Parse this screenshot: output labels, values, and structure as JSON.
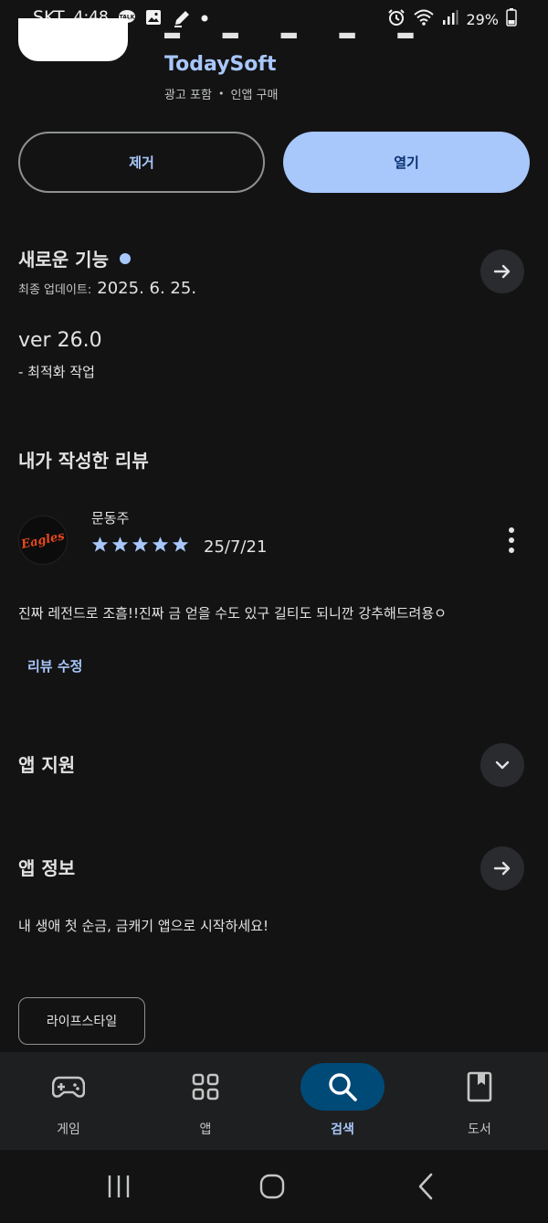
{
  "status_bar": {
    "carrier": "SKT",
    "time": "4:48",
    "battery": "29%",
    "left_icons": [
      "talk-icon",
      "gallery-icon",
      "pen-icon",
      "dot-icon"
    ],
    "right_icons": [
      "alarm-icon",
      "wifi-icon",
      "signal-icon",
      "battery-icon"
    ]
  },
  "app": {
    "developer": "TodaySoft",
    "ads_label": "광고 포함",
    "iap_label": "인앱 구매",
    "separator": "•"
  },
  "buttons": {
    "remove": "제거",
    "open": "열기"
  },
  "whats_new": {
    "title": "새로운 기능",
    "updated_label": "최종 업데이트:",
    "updated_date": "2025. 6. 25.",
    "version": "ver 26.0",
    "note": "- 최적화 작업"
  },
  "my_review": {
    "title": "내가 작성한 리뷰",
    "avatar_text": "Eagles",
    "reviewer": "문동주",
    "rating": 5,
    "date": "25/7/21",
    "text": "진짜 레전드로 조흠!!진짜 금 얻을 수도 있구 길티도 되니깐 강추해드려용ㅇ",
    "edit_label": "리뷰 수정"
  },
  "app_support": {
    "title": "앱 지원"
  },
  "app_info": {
    "title": "앱 정보",
    "description": "내 생애 첫 순금, 금캐기 앱으로 시작하세요!",
    "category_chip": "라이프스타일"
  },
  "bottom_nav": {
    "items": [
      {
        "label": "게임",
        "icon": "gamepad-icon",
        "active": false
      },
      {
        "label": "앱",
        "icon": "apps-grid-icon",
        "active": false
      },
      {
        "label": "검색",
        "icon": "search-icon",
        "active": true
      },
      {
        "label": "도서",
        "icon": "book-icon",
        "active": false
      }
    ]
  },
  "colors": {
    "background": "#131314",
    "accent": "#a8c7fa",
    "nav_background": "#1e1f20",
    "active_pill": "#004a77"
  }
}
